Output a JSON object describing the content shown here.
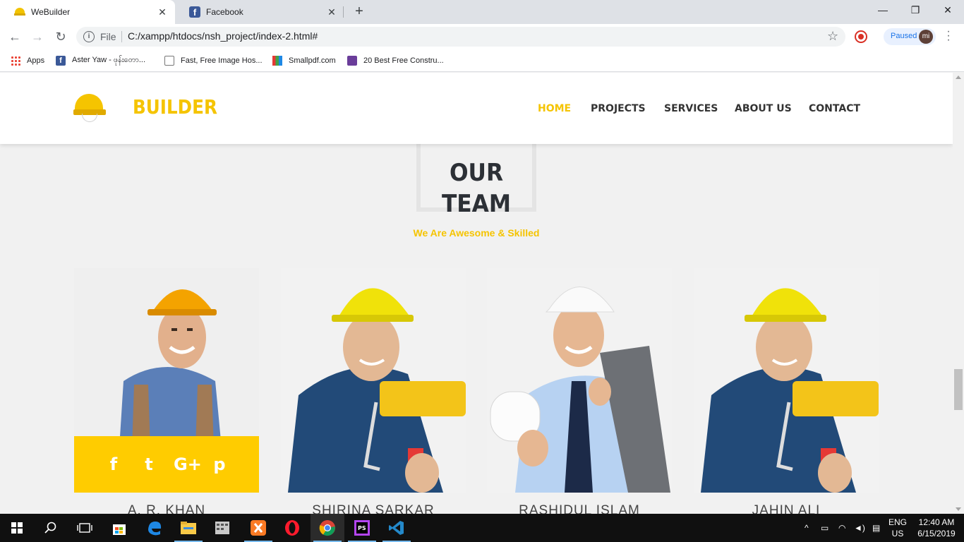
{
  "browser": {
    "tabs": [
      {
        "title": "WeBuilder",
        "icon": "helmet-favicon"
      },
      {
        "title": "Facebook",
        "icon": "facebook-favicon"
      }
    ],
    "new_tab": "+",
    "window_controls": {
      "minimize": "—",
      "restore": "❐",
      "close": "✕"
    },
    "tab_close": "✕",
    "scheme_label": "File",
    "url": "C:/xampp/htdocs/nsh_project/index-2.html#",
    "profile_status": "Paused",
    "profile_initials": "mi",
    "bookmarks": [
      {
        "label": "Apps",
        "icon": "apps-grid-icon"
      },
      {
        "label": "Aster Yaw - ဖုန်းတော...",
        "icon": "facebook-icon"
      },
      {
        "label": "Fast, Free Image Hos...",
        "icon": "image-host-icon"
      },
      {
        "label": "Smallpdf.com",
        "icon": "smallpdf-icon"
      },
      {
        "label": "20 Best Free Constru...",
        "icon": "colorlib-icon"
      }
    ]
  },
  "site": {
    "brand": "BUILDER",
    "nav": [
      {
        "label": "HOME",
        "active": true
      },
      {
        "label": "PROJECTS",
        "active": false
      },
      {
        "label": "SERVICES",
        "active": false
      },
      {
        "label": "ABOUT US",
        "active": false
      },
      {
        "label": "CONTACT",
        "active": false
      }
    ],
    "section_title_line1": "OUR",
    "section_title_line2": "TEAM",
    "section_subtitle": "We Are Awesome & Skilled",
    "social_icons": [
      "f",
      "t",
      "G+",
      "p"
    ],
    "team": [
      {
        "name": "A. R. KHAN",
        "photo": "worker-hardhat-orange"
      },
      {
        "name": "SHIRINA SARKAR",
        "photo": "painter-yellow-helmet"
      },
      {
        "name": "RASHIDUL ISLAM",
        "photo": "engineer-white-helmet"
      },
      {
        "name": "JAHIN ALI",
        "photo": "painter-yellow-helmet"
      }
    ]
  },
  "taskbar": {
    "apps": [
      "start",
      "search",
      "task-view",
      "store",
      "edge",
      "file-explorer",
      "app-grid",
      "xampp",
      "opera",
      "chrome",
      "phpstorm",
      "vscode"
    ],
    "language_line1": "ENG",
    "language_line2": "US",
    "time": "12:40 AM",
    "date": "6/15/2019"
  },
  "colors": {
    "accent": "#f5c400",
    "social_bar": "#ffcc00",
    "heading": "#2c3036"
  }
}
